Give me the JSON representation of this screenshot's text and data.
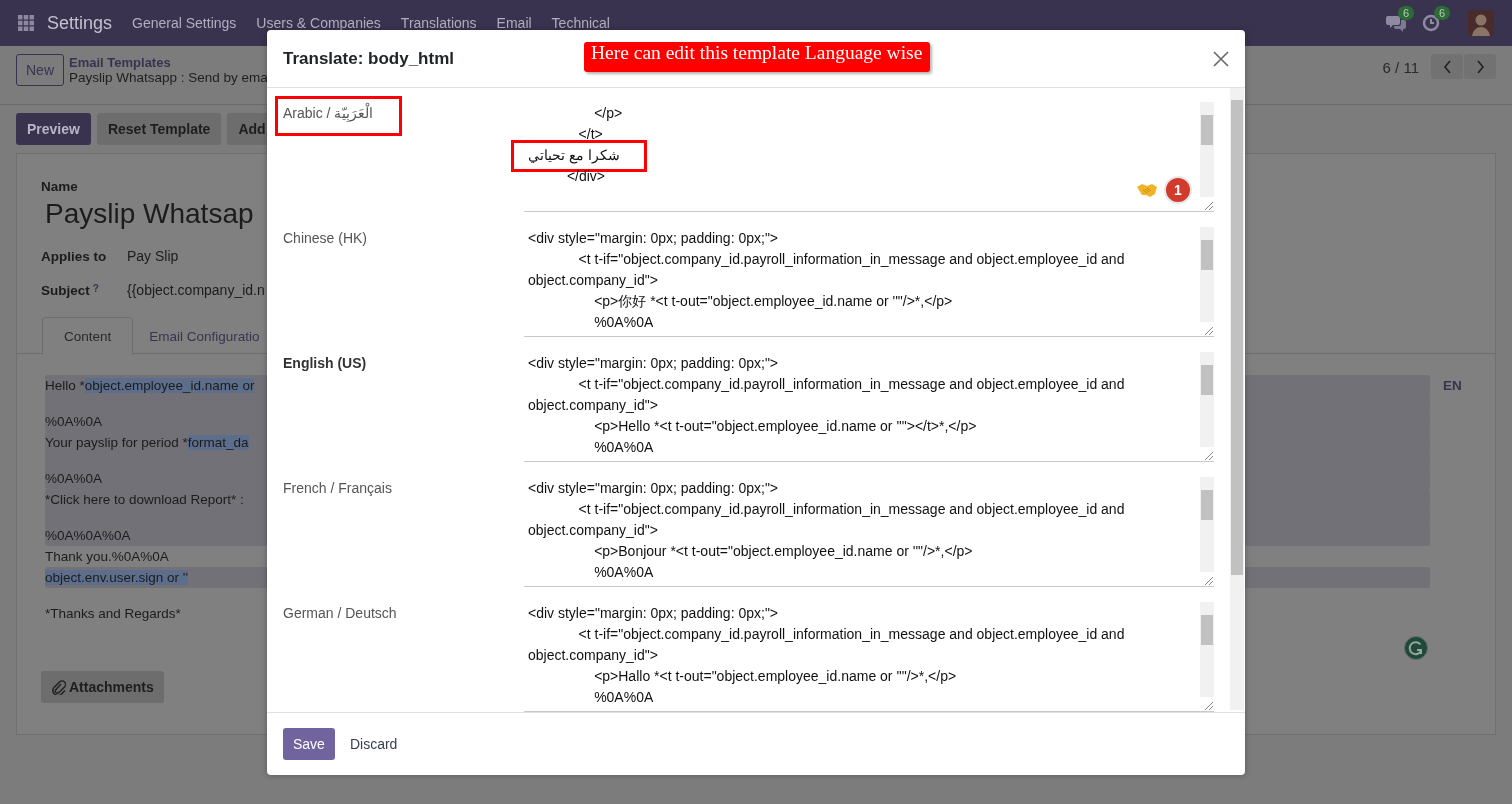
{
  "navbar": {
    "app": "Settings",
    "menu": [
      "General Settings",
      "Users & Companies",
      "Translations",
      "Email",
      "Technical"
    ],
    "messages_badge": "6",
    "activities_badge": "6"
  },
  "control_panel": {
    "new_button": "New",
    "breadcrumb": "Email Templates",
    "record": "Payslip Whatsapp : Send by ema",
    "pager": "6 / 11"
  },
  "actions": [
    {
      "label": "Preview",
      "kind": "primary"
    },
    {
      "label": "Reset Template",
      "kind": "secondary"
    },
    {
      "label": "Add",
      "kind": "secondary"
    }
  ],
  "form": {
    "name_label": "Name",
    "name": "Payslip Whatsap",
    "fields": [
      {
        "label": "Applies to",
        "value": "Pay Slip"
      },
      {
        "label": "Subject",
        "help": "?",
        "value": "{{object.company_id.n"
      }
    ],
    "tabs": [
      {
        "label": "Content",
        "selected": true
      },
      {
        "label": "Email Configuratio",
        "selected": false
      }
    ],
    "body": [
      [
        {
          "shaded": true,
          "segments": [
            {
              "text": "Hello *",
              "code": false
            },
            {
              "text": "object.employee_id.name or",
              "code": true
            }
          ]
        }
      ],
      [
        {
          "shaded": true,
          "segments": [
            {
              "text": "%0A%0A",
              "code": false
            }
          ]
        },
        {
          "shaded": true,
          "segments": [
            {
              "text": "Your payslip for period *",
              "code": false
            },
            {
              "text": "format_da",
              "code": true
            }
          ]
        }
      ],
      [
        {
          "shaded": true,
          "segments": [
            {
              "text": "%0A%0A",
              "code": false
            }
          ]
        },
        {
          "shaded": true,
          "segments": [
            {
              "text": "*Click here to download Report* :",
              "code": false
            }
          ]
        }
      ],
      [
        {
          "shaded": true,
          "segments": [
            {
              "text": "%0A%0A%0A",
              "code": false
            }
          ]
        },
        {
          "shaded": false,
          "segments": [
            {
              "text": "Thank you.%0A%0A",
              "code": false
            }
          ]
        },
        {
          "shaded": true,
          "segments": [
            {
              "text": "object.env.user.sign or ''",
              "code": true
            }
          ]
        }
      ],
      [
        {
          "shaded": false,
          "segments": [
            {
              "text": "*Thanks and Regards*",
              "code": false
            }
          ]
        }
      ]
    ],
    "language": "EN",
    "attachments": "Attachments"
  },
  "dialog": {
    "title": "Translate: body_html",
    "annotation": "Here can edit this template Language wise",
    "languages": [
      {
        "name": "Arabic / الْعَرَبِيّة",
        "current": false,
        "marked": true,
        "badge": "1",
        "lines": [
          {
            "text": "                 </p>",
            "marked": false
          },
          {
            "text": "             </t>",
            "marked": false
          },
          {
            "text": "شكرا مع تحياتي",
            "marked": true
          },
          {
            "text": "          </div>",
            "marked": false
          }
        ]
      },
      {
        "name": "Chinese (HK)",
        "current": false,
        "marked": false,
        "lines": [
          {
            "text": "<div style=\"margin: 0px; padding: 0px;\">",
            "marked": false
          },
          {
            "text": "             <t t-if=\"object.company_id.payroll_information_in_message and object.employee_id and object.company_id\">",
            "marked": false
          },
          {
            "text": "                 <p>你好 *<t t-out=\"object.employee_id.name or ''\"/>*,</p>",
            "marked": false
          },
          {
            "text": "                 %0A%0A",
            "marked": false
          }
        ]
      },
      {
        "name": "English (US)",
        "current": true,
        "marked": false,
        "lines": [
          {
            "text": "<div style=\"margin: 0px; padding: 0px;\">",
            "marked": false
          },
          {
            "text": "             <t t-if=\"object.company_id.payroll_information_in_message and object.employee_id and object.company_id\">",
            "marked": false
          },
          {
            "text": "                 <p>Hello *<t t-out=\"object.employee_id.name or ''\"></t>*,</p>",
            "marked": false
          },
          {
            "text": "                 %0A%0A",
            "marked": false
          }
        ]
      },
      {
        "name": "French / Français",
        "current": false,
        "marked": false,
        "lines": [
          {
            "text": "<div style=\"margin: 0px; padding: 0px;\">",
            "marked": false
          },
          {
            "text": "             <t t-if=\"object.company_id.payroll_information_in_message and object.employee_id and object.company_id\">",
            "marked": false
          },
          {
            "text": "                 <p>Bonjour *<t t-out=\"object.employee_id.name or ''\"/>*,</p>",
            "marked": false
          },
          {
            "text": "                 %0A%0A",
            "marked": false
          }
        ]
      },
      {
        "name": "German / Deutsch",
        "current": false,
        "marked": false,
        "lines": [
          {
            "text": "<div style=\"margin: 0px; padding: 0px;\">",
            "marked": false
          },
          {
            "text": "             <t t-if=\"object.company_id.payroll_information_in_message and object.employee_id and object.company_id\">",
            "marked": false
          },
          {
            "text": "                 <p>Hallo *<t t-out=\"object.employee_id.name or ''\"/>*,</p>",
            "marked": false
          },
          {
            "text": "                 %0A%0A",
            "marked": false
          }
        ]
      }
    ],
    "buttons": [
      {
        "label": "Save",
        "kind": "primary"
      },
      {
        "label": "Discard",
        "kind": "link"
      }
    ]
  }
}
